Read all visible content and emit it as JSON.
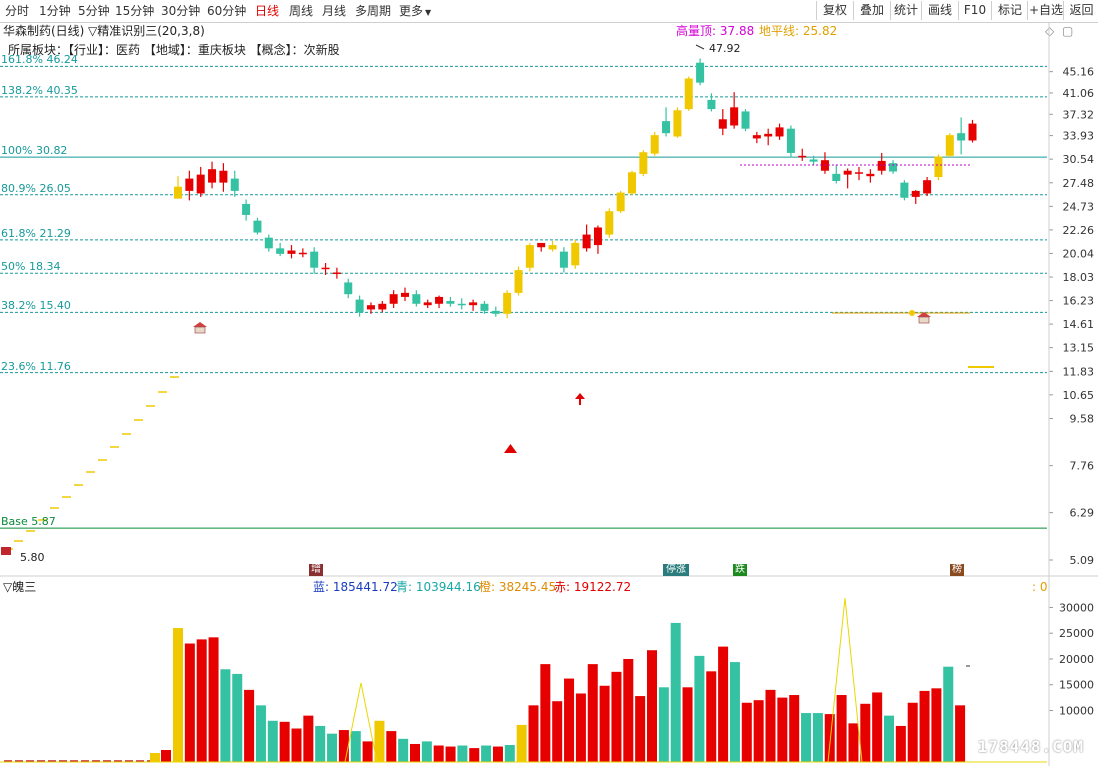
{
  "toolbar": {
    "timeframes": [
      "分时",
      "1分钟",
      "5分钟",
      "15分钟",
      "30分钟",
      "60分钟",
      "日线",
      "周线",
      "月线",
      "多周期",
      "更多"
    ],
    "active_timeframe": "日线",
    "more_arrow": "▼",
    "tools": [
      "复权",
      "叠加",
      "统计",
      "画线",
      "F10",
      "标记",
      "+自选",
      "返回"
    ]
  },
  "stock": {
    "title": "华森制药(日线)",
    "indicator": "▽精准识别三(20,3,8)",
    "high_label": "高量顶: 37.88",
    "low_label": "地平线: 25.82",
    "sector_line": "所属板块：【行业】：医药 【地域】：重庆板块 【概念】：次新股",
    "peak_label": "47.92",
    "base_label": "5.80"
  },
  "fib_levels": [
    {
      "label": "161.8% 46.24",
      "price": 46.24,
      "color": "#169a9a",
      "solid": false
    },
    {
      "label": "138.2% 40.35",
      "price": 40.35,
      "color": "#169a9a",
      "solid": false
    },
    {
      "label": "100% 30.82",
      "price": 30.82,
      "color": "#169a9a",
      "solid": true
    },
    {
      "label": "80.9% 26.05",
      "price": 26.05,
      "color": "#169a9a",
      "solid": false
    },
    {
      "label": "61.8% 21.29",
      "price": 21.29,
      "color": "#169a9a",
      "solid": false
    },
    {
      "label": "50% 18.34",
      "price": 18.34,
      "color": "#169a9a",
      "solid": false
    },
    {
      "label": "38.2% 15.40",
      "price": 15.4,
      "color": "#169a9a",
      "solid": false
    },
    {
      "label": "23.6% 11.76",
      "price": 11.76,
      "color": "#169a9a",
      "solid": false
    },
    {
      "label": "Base 5.87",
      "price": 5.87,
      "color": "#0a8a3a",
      "solid": true
    }
  ],
  "price_axis": [
    "45.16",
    "41.06",
    "37.32",
    "33.93",
    "30.54",
    "27.48",
    "24.73",
    "22.26",
    "20.04",
    "18.03",
    "16.23",
    "14.61",
    "13.15",
    "11.83",
    "10.65",
    "9.58",
    "7.76",
    "6.29",
    "5.09"
  ],
  "markers": [
    {
      "text": "增",
      "bg": "#8a2f2f"
    },
    {
      "text": "停涨",
      "bg": "#2b7d7d"
    },
    {
      "text": "跌",
      "bg": "#1d8a1d"
    },
    {
      "text": "榜",
      "bg": "#8a4a1f"
    }
  ],
  "volume": {
    "title": "▽魄三",
    "legend": [
      {
        "text": "蓝: 185441.72",
        "color": "#1a3cbf"
      },
      {
        "text": "青: 103944.16",
        "color": "#17a7a7"
      },
      {
        "text": "橙: 38245.45",
        "color": "#e08a00"
      },
      {
        "text": "赤: 19122.72",
        "color": "#e00000"
      }
    ],
    "zero_label": ": 0",
    "axis": [
      "30000",
      "25000",
      "20000",
      "15000",
      "10000"
    ]
  },
  "colors": {
    "up": "#e60000",
    "down": "#34c2a2",
    "gold": "#f0c800",
    "line": "#169a9a"
  },
  "watermark": "178448.COM",
  "chart_data": {
    "type": "candlestick",
    "title": "华森制药(日线)",
    "candles": [
      {
        "o": 27.0,
        "h": 28.3,
        "l": 25.8,
        "c": 25.6,
        "k": "g"
      },
      {
        "o": 26.5,
        "h": 29.0,
        "l": 25.4,
        "c": 28.0,
        "k": "r"
      },
      {
        "o": 26.2,
        "h": 29.5,
        "l": 25.8,
        "c": 28.5,
        "k": "r"
      },
      {
        "o": 27.5,
        "h": 30.2,
        "l": 26.8,
        "c": 29.2,
        "k": "r"
      },
      {
        "o": 27.5,
        "h": 30.0,
        "l": 26.4,
        "c": 29.0,
        "k": "r"
      },
      {
        "o": 28.0,
        "h": 29.0,
        "l": 25.8,
        "c": 26.5,
        "k": "d"
      },
      {
        "o": 25.0,
        "h": 25.5,
        "l": 23.2,
        "c": 23.8,
        "k": "d"
      },
      {
        "o": 23.2,
        "h": 23.5,
        "l": 21.8,
        "c": 22.0,
        "k": "d"
      },
      {
        "o": 21.5,
        "h": 21.8,
        "l": 20.2,
        "c": 20.5,
        "k": "d"
      },
      {
        "o": 20.5,
        "h": 21.0,
        "l": 19.8,
        "c": 20.0,
        "k": "d"
      },
      {
        "o": 20.0,
        "h": 20.8,
        "l": 19.6,
        "c": 20.3,
        "k": "r"
      },
      {
        "o": 20.1,
        "h": 20.5,
        "l": 19.7,
        "c": 20.0,
        "k": "r"
      },
      {
        "o": 20.2,
        "h": 20.6,
        "l": 18.3,
        "c": 18.8,
        "k": "d"
      },
      {
        "o": 18.8,
        "h": 19.2,
        "l": 18.2,
        "c": 18.7,
        "k": "r"
      },
      {
        "o": 18.4,
        "h": 18.8,
        "l": 17.9,
        "c": 18.3,
        "k": "r"
      },
      {
        "o": 17.6,
        "h": 17.9,
        "l": 16.4,
        "c": 16.7,
        "k": "d"
      },
      {
        "o": 16.3,
        "h": 16.6,
        "l": 15.1,
        "c": 15.4,
        "k": "d"
      },
      {
        "o": 15.6,
        "h": 16.1,
        "l": 15.3,
        "c": 15.9,
        "k": "r"
      },
      {
        "o": 15.6,
        "h": 16.2,
        "l": 15.4,
        "c": 16.0,
        "k": "r"
      },
      {
        "o": 16.0,
        "h": 17.0,
        "l": 15.7,
        "c": 16.7,
        "k": "r"
      },
      {
        "o": 16.5,
        "h": 17.2,
        "l": 16.2,
        "c": 16.8,
        "k": "r"
      },
      {
        "o": 16.7,
        "h": 17.0,
        "l": 15.8,
        "c": 16.0,
        "k": "d"
      },
      {
        "o": 15.9,
        "h": 16.3,
        "l": 15.7,
        "c": 16.1,
        "k": "r"
      },
      {
        "o": 16.0,
        "h": 16.6,
        "l": 15.7,
        "c": 16.5,
        "k": "r"
      },
      {
        "o": 16.2,
        "h": 16.5,
        "l": 15.8,
        "c": 16.0,
        "k": "d"
      },
      {
        "o": 16.0,
        "h": 16.4,
        "l": 15.6,
        "c": 15.9,
        "k": "d"
      },
      {
        "o": 15.9,
        "h": 16.3,
        "l": 15.5,
        "c": 16.1,
        "k": "r"
      },
      {
        "o": 16.0,
        "h": 16.2,
        "l": 15.3,
        "c": 15.5,
        "k": "d"
      },
      {
        "o": 15.5,
        "h": 15.8,
        "l": 15.1,
        "c": 15.3,
        "k": "d"
      },
      {
        "o": 15.3,
        "h": 17.0,
        "l": 15.0,
        "c": 16.8,
        "k": "y"
      },
      {
        "o": 16.8,
        "h": 18.9,
        "l": 16.6,
        "c": 18.6,
        "k": "y"
      },
      {
        "o": 18.8,
        "h": 21.0,
        "l": 18.5,
        "c": 20.8,
        "k": "y"
      },
      {
        "o": 20.6,
        "h": 21.0,
        "l": 20.2,
        "c": 21.0,
        "k": "r"
      },
      {
        "o": 20.8,
        "h": 21.2,
        "l": 20.2,
        "c": 20.4,
        "k": "y"
      },
      {
        "o": 20.2,
        "h": 20.6,
        "l": 18.4,
        "c": 18.8,
        "k": "d"
      },
      {
        "o": 19.0,
        "h": 21.3,
        "l": 18.7,
        "c": 21.0,
        "k": "y"
      },
      {
        "o": 20.5,
        "h": 22.8,
        "l": 20.2,
        "c": 21.8,
        "k": "r"
      },
      {
        "o": 20.8,
        "h": 22.7,
        "l": 20.0,
        "c": 22.5,
        "k": "r"
      },
      {
        "o": 21.8,
        "h": 24.5,
        "l": 21.5,
        "c": 24.2,
        "k": "y"
      },
      {
        "o": 24.2,
        "h": 26.5,
        "l": 24.0,
        "c": 26.3,
        "k": "y"
      },
      {
        "o": 26.2,
        "h": 29.0,
        "l": 26.0,
        "c": 28.8,
        "k": "y"
      },
      {
        "o": 28.6,
        "h": 31.8,
        "l": 28.3,
        "c": 31.5,
        "k": "y"
      },
      {
        "o": 31.3,
        "h": 34.5,
        "l": 31.0,
        "c": 34.0,
        "k": "y"
      },
      {
        "o": 34.3,
        "h": 38.5,
        "l": 33.8,
        "c": 36.2,
        "k": "d"
      },
      {
        "o": 33.8,
        "h": 38.5,
        "l": 33.6,
        "c": 38.0,
        "k": "y"
      },
      {
        "o": 38.2,
        "h": 44.2,
        "l": 37.9,
        "c": 43.8,
        "k": "y"
      },
      {
        "o": 43.0,
        "h": 47.9,
        "l": 42.5,
        "c": 47.0,
        "k": "d"
      },
      {
        "o": 39.8,
        "h": 41.0,
        "l": 37.8,
        "c": 38.2,
        "k": "d"
      },
      {
        "o": 35.0,
        "h": 38.2,
        "l": 34.0,
        "c": 36.5,
        "k": "r"
      },
      {
        "o": 35.5,
        "h": 41.2,
        "l": 35.0,
        "c": 38.5,
        "k": "r"
      },
      {
        "o": 37.8,
        "h": 38.2,
        "l": 34.6,
        "c": 35.0,
        "k": "d"
      },
      {
        "o": 33.5,
        "h": 34.5,
        "l": 32.8,
        "c": 34.0,
        "k": "r"
      },
      {
        "o": 33.8,
        "h": 35.0,
        "l": 32.5,
        "c": 34.2,
        "k": "r"
      },
      {
        "o": 33.8,
        "h": 35.8,
        "l": 33.3,
        "c": 35.2,
        "k": "r"
      },
      {
        "o": 35.0,
        "h": 35.5,
        "l": 30.8,
        "c": 31.4,
        "k": "d"
      },
      {
        "o": 31.0,
        "h": 32.0,
        "l": 30.3,
        "c": 30.9,
        "k": "r"
      },
      {
        "o": 30.5,
        "h": 31.0,
        "l": 29.8,
        "c": 30.2,
        "k": "d"
      },
      {
        "o": 30.4,
        "h": 31.5,
        "l": 28.6,
        "c": 29.0,
        "k": "r"
      },
      {
        "o": 28.6,
        "h": 29.8,
        "l": 27.4,
        "c": 27.7,
        "k": "d"
      },
      {
        "o": 28.5,
        "h": 29.3,
        "l": 26.8,
        "c": 29.0,
        "k": "r"
      },
      {
        "o": 28.8,
        "h": 29.5,
        "l": 27.8,
        "c": 28.8,
        "k": "r"
      },
      {
        "o": 28.6,
        "h": 29.2,
        "l": 27.5,
        "c": 28.3,
        "k": "r"
      },
      {
        "o": 29.0,
        "h": 31.4,
        "l": 28.5,
        "c": 30.3,
        "k": "r"
      },
      {
        "o": 30.0,
        "h": 30.4,
        "l": 28.6,
        "c": 28.9,
        "k": "d"
      },
      {
        "o": 27.5,
        "h": 27.8,
        "l": 25.4,
        "c": 25.7,
        "k": "d"
      },
      {
        "o": 25.8,
        "h": 26.6,
        "l": 25.0,
        "c": 26.5,
        "k": "r"
      },
      {
        "o": 26.2,
        "h": 28.2,
        "l": 25.9,
        "c": 27.8,
        "k": "r"
      },
      {
        "o": 28.2,
        "h": 31.2,
        "l": 27.8,
        "c": 30.9,
        "k": "y"
      },
      {
        "o": 31.0,
        "h": 34.3,
        "l": 30.8,
        "c": 34.0,
        "k": "y"
      },
      {
        "o": 34.3,
        "h": 36.8,
        "l": 31.2,
        "c": 33.2,
        "k": "d"
      },
      {
        "o": 33.2,
        "h": 36.4,
        "l": 32.9,
        "c": 35.8,
        "k": "r"
      }
    ],
    "volumes": [
      {
        "v": 26000,
        "k": "y"
      },
      {
        "v": 23000,
        "k": "r"
      },
      {
        "v": 23800,
        "k": "r"
      },
      {
        "v": 24200,
        "k": "r"
      },
      {
        "v": 18000,
        "k": "g"
      },
      {
        "v": 17100,
        "k": "g"
      },
      {
        "v": 14000,
        "k": "r"
      },
      {
        "v": 11000,
        "k": "g"
      },
      {
        "v": 8000,
        "k": "g"
      },
      {
        "v": 7800,
        "k": "r"
      },
      {
        "v": 6500,
        "k": "r"
      },
      {
        "v": 9000,
        "k": "r"
      },
      {
        "v": 7000,
        "k": "g"
      },
      {
        "v": 5500,
        "k": "g"
      },
      {
        "v": 6200,
        "k": "r"
      },
      {
        "v": 6000,
        "k": "g"
      },
      {
        "v": 4000,
        "k": "r"
      },
      {
        "v": 8000,
        "k": "y"
      },
      {
        "v": 6000,
        "k": "r"
      },
      {
        "v": 4500,
        "k": "g"
      },
      {
        "v": 3500,
        "k": "r"
      },
      {
        "v": 4000,
        "k": "g"
      },
      {
        "v": 3200,
        "k": "r"
      },
      {
        "v": 3000,
        "k": "r"
      },
      {
        "v": 3200,
        "k": "g"
      },
      {
        "v": 2700,
        "k": "r"
      },
      {
        "v": 3200,
        "k": "g"
      },
      {
        "v": 3000,
        "k": "r"
      },
      {
        "v": 3300,
        "k": "g"
      },
      {
        "v": 7200,
        "k": "y"
      },
      {
        "v": 11000,
        "k": "r"
      },
      {
        "v": 19000,
        "k": "r"
      },
      {
        "v": 11800,
        "k": "r"
      },
      {
        "v": 16200,
        "k": "r"
      },
      {
        "v": 13300,
        "k": "r"
      },
      {
        "v": 19000,
        "k": "r"
      },
      {
        "v": 14800,
        "k": "r"
      },
      {
        "v": 17500,
        "k": "r"
      },
      {
        "v": 20000,
        "k": "r"
      },
      {
        "v": 12800,
        "k": "r"
      },
      {
        "v": 21700,
        "k": "r"
      },
      {
        "v": 14500,
        "k": "g"
      },
      {
        "v": 27000,
        "k": "g"
      },
      {
        "v": 14500,
        "k": "r"
      },
      {
        "v": 20600,
        "k": "g"
      },
      {
        "v": 17600,
        "k": "r"
      },
      {
        "v": 22400,
        "k": "r"
      },
      {
        "v": 19400,
        "k": "g"
      },
      {
        "v": 11500,
        "k": "r"
      },
      {
        "v": 12000,
        "k": "r"
      },
      {
        "v": 14000,
        "k": "r"
      },
      {
        "v": 12500,
        "k": "r"
      },
      {
        "v": 13000,
        "k": "r"
      },
      {
        "v": 9500,
        "k": "g"
      },
      {
        "v": 9500,
        "k": "g"
      },
      {
        "v": 9300,
        "k": "r"
      },
      {
        "v": 13000,
        "k": "r"
      },
      {
        "v": 7500,
        "k": "r"
      },
      {
        "v": 11300,
        "k": "r"
      },
      {
        "v": 13500,
        "k": "r"
      },
      {
        "v": 9000,
        "k": "g"
      },
      {
        "v": 7000,
        "k": "r"
      },
      {
        "v": 11500,
        "k": "r"
      },
      {
        "v": 13800,
        "k": "r"
      },
      {
        "v": 14300,
        "k": "r"
      },
      {
        "v": 18500,
        "k": "g"
      },
      {
        "v": 11000,
        "k": "r"
      }
    ],
    "volume_ylim": [
      0,
      33000
    ],
    "price_range": [
      5.09,
      48.0
    ]
  }
}
